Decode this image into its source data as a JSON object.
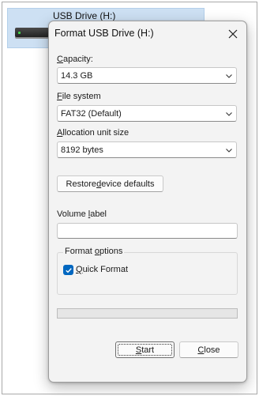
{
  "explorer": {
    "drive_name": "USB Drive (H:)"
  },
  "dialog": {
    "title": "Format USB Drive (H:)",
    "capacity": {
      "label_prefix": "",
      "label_accel": "C",
      "label_rest": "apacity:",
      "value": "14.3 GB"
    },
    "file_system": {
      "label_accel": "F",
      "label_rest": "ile system",
      "value": "FAT32 (Default)"
    },
    "allocation": {
      "label_accel": "A",
      "label_rest": "llocation unit size",
      "value": "8192 bytes"
    },
    "restore": {
      "label_pre": "Restore ",
      "label_accel": "d",
      "label_post": "evice defaults"
    },
    "volume_label": {
      "label_pre": "Volume ",
      "label_accel": "l",
      "label_post": "abel",
      "value": ""
    },
    "format_options": {
      "title_pre": "Format ",
      "title_accel": "o",
      "title_post": "ptions",
      "quick_format": {
        "label_accel": "Q",
        "label_rest": "uick Format",
        "checked": true
      }
    },
    "progress": 0,
    "start": {
      "label_accel": "S",
      "label_rest": "tart"
    },
    "close": {
      "label_accel": "C",
      "label_rest": "lose"
    }
  },
  "colors": {
    "accent": "#0067c0",
    "selection": "#cde0f3",
    "dialog_bg": "#f3f3f3",
    "progress": "#06b025"
  },
  "icons": {
    "close": "close-icon",
    "dropdown": "chevron-down-icon",
    "check": "checkmark-icon",
    "drive": "usb-drive-icon"
  }
}
